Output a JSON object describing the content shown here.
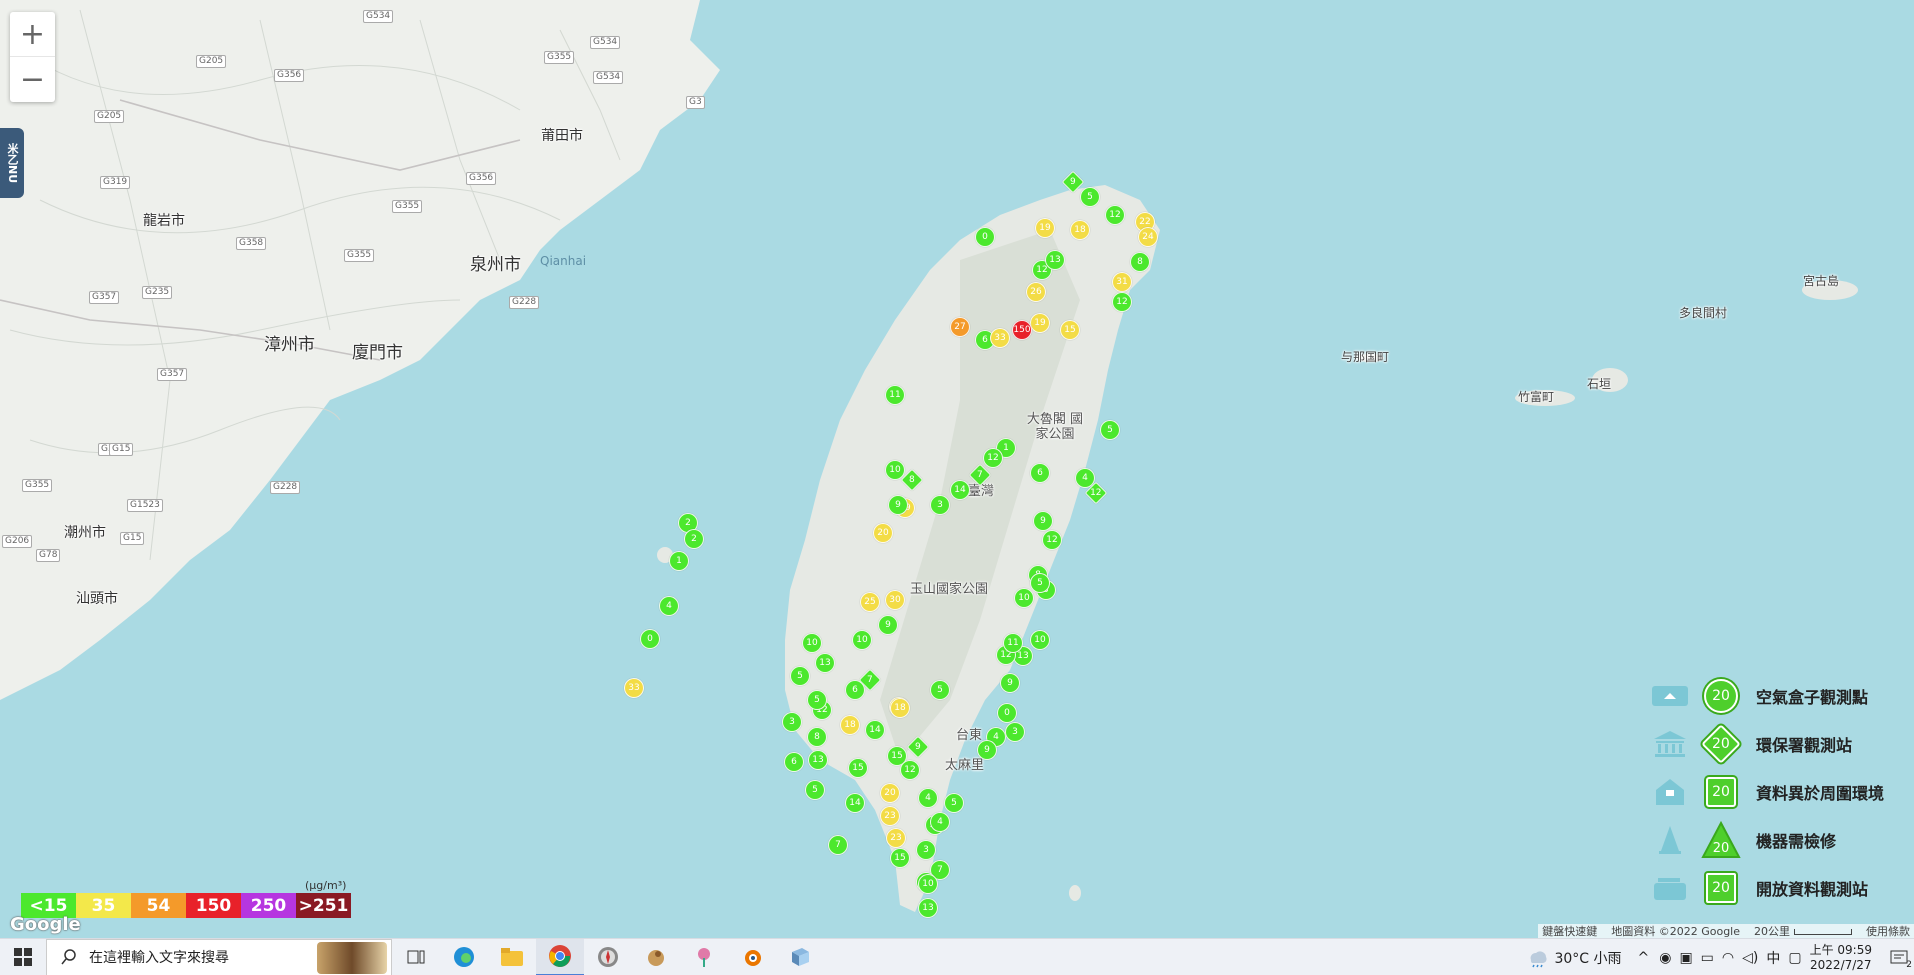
{
  "map": {
    "zoom_in": "+",
    "zoom_out": "−",
    "side_tab": "米乙NU",
    "places": [
      {
        "name": "莆田市"
      },
      {
        "name": "龍岩市"
      },
      {
        "name": "泉州市"
      },
      {
        "name": "Qianhai"
      },
      {
        "name": "漳州市"
      },
      {
        "name": "廈門市"
      },
      {
        "name": "潮州市"
      },
      {
        "name": "汕頭市"
      },
      {
        "name": "大魯閣 國家公園"
      },
      {
        "name": "玉山國家公園"
      },
      {
        "name": "臺灣"
      },
      {
        "name": "太麻里"
      },
      {
        "name": "与那国町"
      },
      {
        "name": "竹富町"
      },
      {
        "name": "石垣"
      },
      {
        "name": "多良間村"
      },
      {
        "name": "宮古島"
      },
      {
        "name": "台東"
      }
    ],
    "roads": [
      "G534",
      "G534",
      "G205",
      "G356",
      "G355",
      "G534",
      "G3",
      "G205",
      "G319",
      "G356",
      "G355",
      "G358",
      "G355",
      "G235",
      "G357",
      "G228",
      "G355",
      "G357",
      "G15",
      "G1523",
      "G228",
      "G206",
      "G78",
      "G15",
      "G355"
    ]
  },
  "air_markers": {
    "colors": {
      "green": "#4ce82d",
      "yellow": "#f3dc46",
      "orange": "#f49a2a",
      "red": "#e8212a"
    },
    "points": [
      [
        "9",
        "d",
        "g"
      ],
      [
        "5",
        "c",
        "g"
      ],
      [
        "12",
        "c",
        "g"
      ],
      [
        "22",
        "c",
        "y"
      ],
      [
        "24",
        "c",
        "y"
      ],
      [
        "8",
        "c",
        "g"
      ],
      [
        "18",
        "c",
        "y"
      ],
      [
        "19",
        "c",
        "y"
      ],
      [
        "31",
        "c",
        "y"
      ],
      [
        "12",
        "c",
        "g"
      ],
      [
        "15",
        "c",
        "y"
      ],
      [
        "27",
        "c",
        "o"
      ],
      [
        "19",
        "c",
        "y"
      ],
      [
        "6",
        "c",
        "g"
      ],
      [
        "12",
        "c",
        "g"
      ],
      [
        "13",
        "c",
        "g"
      ],
      [
        "0",
        "c",
        "g"
      ],
      [
        "26",
        "c",
        "y"
      ],
      [
        "33",
        "c",
        "y"
      ],
      [
        "1",
        "c",
        "g"
      ],
      [
        "12",
        "c",
        "g"
      ],
      [
        "7",
        "d",
        "g"
      ],
      [
        "14",
        "c",
        "g"
      ],
      [
        "3",
        "c",
        "g"
      ],
      [
        "8",
        "d",
        "g"
      ],
      [
        "10",
        "c",
        "g"
      ],
      [
        "6",
        "c",
        "g"
      ],
      [
        "5",
        "c",
        "g"
      ],
      [
        "4",
        "c",
        "g"
      ],
      [
        "12",
        "d",
        "g"
      ],
      [
        "19",
        "c",
        "y"
      ],
      [
        "20",
        "c",
        "y"
      ],
      [
        "9",
        "c",
        "g"
      ],
      [
        "30",
        "c",
        "y"
      ],
      [
        "25",
        "c",
        "y"
      ],
      [
        "10",
        "c",
        "g"
      ],
      [
        "18",
        "c",
        "y"
      ],
      [
        "9",
        "d",
        "g"
      ],
      [
        "15",
        "c",
        "g"
      ],
      [
        "7",
        "d",
        "g"
      ],
      [
        "6",
        "c",
        "g"
      ],
      [
        "12",
        "c",
        "g"
      ],
      [
        "18",
        "c",
        "y"
      ],
      [
        "14",
        "c",
        "g"
      ],
      [
        "13",
        "c",
        "g"
      ],
      [
        "5",
        "c",
        "g"
      ],
      [
        "20",
        "c",
        "y"
      ],
      [
        "23",
        "c",
        "y"
      ],
      [
        "5",
        "c",
        "g"
      ],
      [
        "10",
        "c",
        "g"
      ],
      [
        "13",
        "c",
        "g"
      ],
      [
        "9",
        "c",
        "g"
      ],
      [
        "0",
        "c",
        "g"
      ],
      [
        "4",
        "c",
        "g"
      ],
      [
        "9",
        "c",
        "g"
      ],
      [
        "3",
        "c",
        "g"
      ],
      [
        "9",
        "c",
        "g"
      ],
      [
        "12",
        "c",
        "g"
      ],
      [
        "8",
        "c",
        "g"
      ],
      [
        "5",
        "c",
        "g"
      ],
      [
        "10",
        "c",
        "g"
      ],
      [
        "12",
        "c",
        "g"
      ],
      [
        "11",
        "c",
        "g"
      ],
      [
        "2",
        "c",
        "g"
      ],
      [
        "2",
        "c",
        "g"
      ],
      [
        "1",
        "c",
        "g"
      ],
      [
        "4",
        "c",
        "g"
      ],
      [
        "0",
        "c",
        "g"
      ],
      [
        "33",
        "c",
        "y"
      ],
      [
        "5",
        "c",
        "g"
      ],
      [
        "8",
        "c",
        "g"
      ],
      [
        "6",
        "c",
        "g"
      ],
      [
        "12",
        "c",
        "g"
      ],
      [
        "4",
        "c",
        "g"
      ],
      [
        "5",
        "c",
        "g"
      ],
      [
        "11",
        "c",
        "g"
      ],
      [
        "3",
        "c",
        "g"
      ],
      [
        "7",
        "c",
        "g"
      ],
      [
        "8",
        "c",
        "g"
      ],
      [
        "13",
        "c",
        "g"
      ],
      [
        "4",
        "c",
        "g"
      ],
      [
        "15",
        "c",
        "g"
      ],
      [
        "10",
        "c",
        "g"
      ],
      [
        "7",
        "c",
        "g"
      ],
      [
        "23",
        "c",
        "y"
      ],
      [
        "18",
        "c",
        "y"
      ],
      [
        "15",
        "c",
        "g"
      ],
      [
        "14",
        "c",
        "g"
      ],
      [
        "3",
        "c",
        "g"
      ],
      [
        "5",
        "c",
        "g"
      ],
      [
        "13",
        "c",
        "g"
      ],
      [
        "10",
        "c",
        "g"
      ],
      [
        "5",
        "c",
        "g"
      ],
      [
        "9",
        "c",
        "g"
      ],
      [
        "150",
        "c",
        "r"
      ],
      [
        "11",
        "c",
        "g"
      ]
    ]
  },
  "colorbar": {
    "unit": "(μg/m³)",
    "items": [
      {
        "label": "<15",
        "color": "#4ce82d"
      },
      {
        "label": "35",
        "color": "#f3e84a"
      },
      {
        "label": "54",
        "color": "#f49a2a"
      },
      {
        "label": "150",
        "color": "#e8212a"
      },
      {
        "label": "250",
        "color": "#b636e0"
      },
      {
        "label": ">251",
        "color": "#8a1a24"
      }
    ]
  },
  "google_logo": "Google",
  "legend": {
    "items": [
      {
        "value": "20",
        "label": "空氣盒子觀測點",
        "shape": "circle",
        "icon": "airbox-icon"
      },
      {
        "value": "20",
        "label": "環保署觀測站",
        "shape": "diamond",
        "icon": "government-building-icon"
      },
      {
        "value": "20",
        "label": "資料異於周圍環境",
        "shape": "house",
        "icon": "house-icon"
      },
      {
        "value": "20",
        "label": "機器需檢修",
        "shape": "triangle",
        "icon": "cone-icon"
      },
      {
        "value": "20",
        "label": "開放資料觀測站",
        "shape": "square",
        "icon": "open-data-icon"
      }
    ]
  },
  "attribution": {
    "shortcuts": "鍵盤快速鍵",
    "map_data": "地圖資料 ©2022 Google",
    "scale": "20公里",
    "terms": "使用條款"
  },
  "taskbar": {
    "search_placeholder": "在這裡輸入文字來搜尋",
    "apps": [
      "task-view-icon",
      "edge-icon",
      "file-explorer-icon",
      "chrome-icon",
      "app-compass-icon",
      "app-bird-icon",
      "app-flower-icon",
      "blender-icon",
      "app-box-icon"
    ],
    "weather": "30°C  小雨",
    "ime": "中",
    "time": "上午 09:59",
    "date": "2022/7/27",
    "notification_count": "2"
  }
}
